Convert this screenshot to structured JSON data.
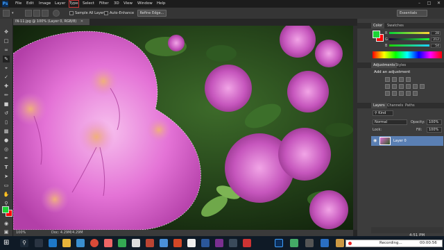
{
  "menubar": {
    "app_logo": "Ps",
    "items": [
      "File",
      "Edit",
      "Image",
      "Layer",
      "Type",
      "Select",
      "Filter",
      "3D",
      "View",
      "Window",
      "Help"
    ]
  },
  "options_bar": {
    "sample_all_layers": "Sample All Layers",
    "auto_enhance": "Auto-Enhance",
    "refine_edge": "Refine Edge...",
    "workspace": "Essentials"
  },
  "document": {
    "tab_title": "IN-11.jpg @ 100% (Layer 0, RGB/8)",
    "zoom": "100%",
    "doc_size": "Doc: 4.29M/4.29M"
  },
  "color_panel": {
    "tabs": [
      "Color",
      "Swatches"
    ],
    "channels": [
      {
        "label": "R",
        "value": "28"
      },
      {
        "label": "G",
        "value": "212"
      },
      {
        "label": "B",
        "value": "54"
      }
    ],
    "foreground_color": "#1cd436",
    "background_color": "#ff0000"
  },
  "adjustments_panel": {
    "tabs": [
      "Adjustments",
      "Styles"
    ],
    "heading": "Add an adjustment"
  },
  "layers_panel": {
    "tabs": [
      "Layers",
      "Channels",
      "Paths"
    ],
    "kind_filter": "Kind",
    "blend_mode": "Normal",
    "opacity_label": "Opacity:",
    "opacity_value": "100%",
    "lock_label": "Lock:",
    "fill_label": "Fill:",
    "fill_value": "100%",
    "layers": [
      {
        "name": "Layer 0"
      }
    ]
  },
  "taskbar": {
    "time": "4:51 PM",
    "recording_label": "Recording...",
    "recording_time": "00:00:56"
  }
}
